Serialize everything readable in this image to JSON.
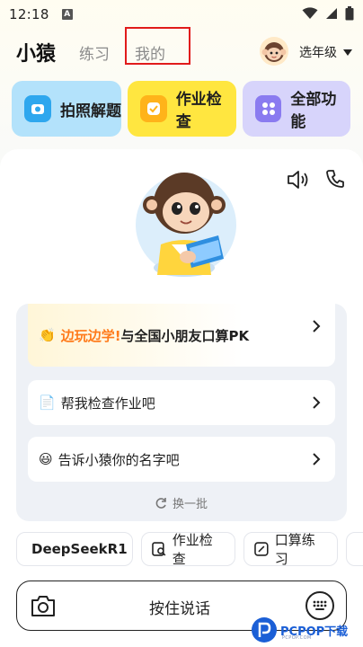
{
  "status_bar": {
    "time": "12:18",
    "notification_letter": "A"
  },
  "top_nav": {
    "brand": "小猿",
    "tabs": [
      {
        "label": "练习"
      },
      {
        "label": "我的"
      }
    ],
    "grade_label": "选年级",
    "highlight_color": "#e11b1b"
  },
  "quick_actions": [
    {
      "label": "拍照解题",
      "icon": "camera-icon",
      "color": "#b3e2fb"
    },
    {
      "label": "作业检查",
      "icon": "check-icon",
      "color": "#ffe640"
    },
    {
      "label": "全部功能",
      "icon": "grid-icon",
      "color": "#d7d4fb"
    }
  ],
  "assistant": {
    "speaker_icon": "speaker-icon",
    "phone_icon": "phone-icon"
  },
  "suggestions": [
    {
      "prefix": "边玩边学!",
      "label": "与全国小朋友口算PK",
      "emoji": "👏"
    },
    {
      "label": "帮我检查作业吧",
      "emoji": "📄"
    },
    {
      "label": "告诉小猿你的名字吧",
      "emoji": "😃"
    }
  ],
  "refresh_label": "换一批",
  "chips": [
    {
      "label": "DeepSeekR1",
      "icon": "deepseek-icon"
    },
    {
      "label": "作业检查",
      "icon": "homework-check-icon"
    },
    {
      "label": "口算练习",
      "icon": "math-practice-icon"
    }
  ],
  "input_bar": {
    "hold_to_talk_label": "按住说话"
  },
  "watermark": {
    "text": "PCPOP下载",
    "sub": "PCPOP.COM"
  },
  "colors": {
    "accent_blue": "#2ea7ee",
    "accent_yellow": "#ffe640",
    "accent_purple": "#8a7bf0",
    "promo_orange": "#ff7a1a"
  }
}
